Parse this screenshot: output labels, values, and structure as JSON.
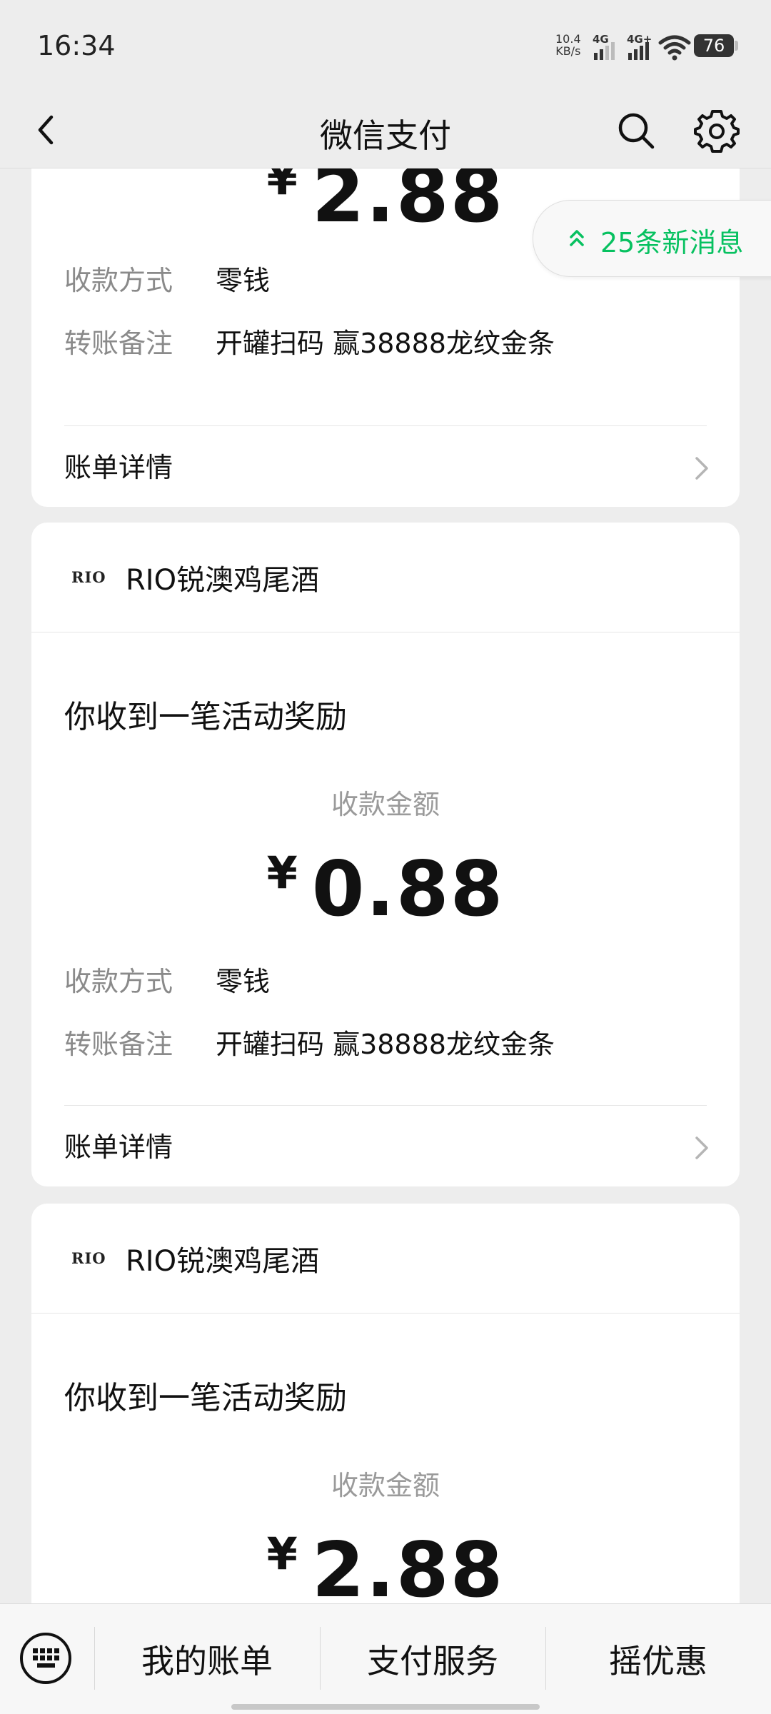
{
  "status": {
    "time": "16:34",
    "net_speed_value": "10.4",
    "net_speed_unit": "KB/s",
    "sim1": "4G",
    "sim2": "4G+",
    "battery": "76"
  },
  "nav": {
    "title": "微信支付"
  },
  "new_messages": "25条新消息",
  "cards": [
    {
      "currency": "¥",
      "amount": "2.88",
      "method_key": "收款方式",
      "method_value": "零钱",
      "note_key": "转账备注",
      "note_value": "开罐扫码 赢38888龙纹金条",
      "detail": "账单详情"
    },
    {
      "brand_logo": "RIO",
      "brand": "RIO锐澳鸡尾酒",
      "title": "你收到一笔活动奖励",
      "amount_label": "收款金额",
      "currency": "¥",
      "amount": "0.88",
      "method_key": "收款方式",
      "method_value": "零钱",
      "note_key": "转账备注",
      "note_value": "开罐扫码 赢38888龙纹金条",
      "detail": "账单详情"
    },
    {
      "brand_logo": "RIO",
      "brand": "RIO锐澳鸡尾酒",
      "title": "你收到一笔活动奖励",
      "amount_label": "收款金额",
      "currency": "¥",
      "amount": "2.88"
    }
  ],
  "bottom_tabs": [
    "我的账单",
    "支付服务",
    "摇优惠"
  ],
  "icons": {
    "back": "chevron-left-icon",
    "search": "search-icon",
    "settings": "gear-icon",
    "keyboard": "keyboard-icon",
    "chevron": "chevron-right-icon",
    "up": "double-chevron-up-icon"
  },
  "colors": {
    "accent": "#07c160",
    "background": "#ededed",
    "card": "#ffffff"
  }
}
